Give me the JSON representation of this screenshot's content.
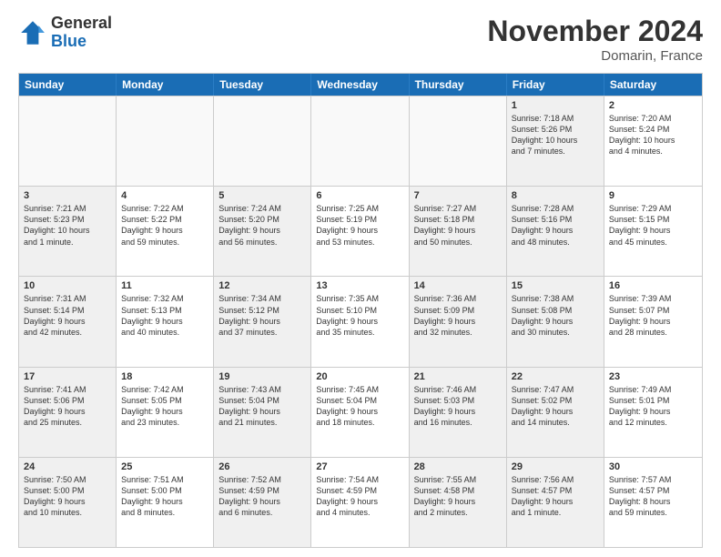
{
  "header": {
    "logo_general": "General",
    "logo_blue": "Blue",
    "month_title": "November 2024",
    "location": "Domarin, France"
  },
  "calendar": {
    "days_of_week": [
      "Sunday",
      "Monday",
      "Tuesday",
      "Wednesday",
      "Thursday",
      "Friday",
      "Saturday"
    ],
    "rows": [
      [
        {
          "day": "",
          "empty": true
        },
        {
          "day": "",
          "empty": true
        },
        {
          "day": "",
          "empty": true
        },
        {
          "day": "",
          "empty": true
        },
        {
          "day": "",
          "empty": true
        },
        {
          "day": "1",
          "text": "Sunrise: 7:18 AM\nSunset: 5:26 PM\nDaylight: 10 hours\nand 7 minutes.",
          "shaded": true
        },
        {
          "day": "2",
          "text": "Sunrise: 7:20 AM\nSunset: 5:24 PM\nDaylight: 10 hours\nand 4 minutes.",
          "shaded": false
        }
      ],
      [
        {
          "day": "3",
          "text": "Sunrise: 7:21 AM\nSunset: 5:23 PM\nDaylight: 10 hours\nand 1 minute.",
          "shaded": true
        },
        {
          "day": "4",
          "text": "Sunrise: 7:22 AM\nSunset: 5:22 PM\nDaylight: 9 hours\nand 59 minutes.",
          "shaded": false
        },
        {
          "day": "5",
          "text": "Sunrise: 7:24 AM\nSunset: 5:20 PM\nDaylight: 9 hours\nand 56 minutes.",
          "shaded": true
        },
        {
          "day": "6",
          "text": "Sunrise: 7:25 AM\nSunset: 5:19 PM\nDaylight: 9 hours\nand 53 minutes.",
          "shaded": false
        },
        {
          "day": "7",
          "text": "Sunrise: 7:27 AM\nSunset: 5:18 PM\nDaylight: 9 hours\nand 50 minutes.",
          "shaded": true
        },
        {
          "day": "8",
          "text": "Sunrise: 7:28 AM\nSunset: 5:16 PM\nDaylight: 9 hours\nand 48 minutes.",
          "shaded": true
        },
        {
          "day": "9",
          "text": "Sunrise: 7:29 AM\nSunset: 5:15 PM\nDaylight: 9 hours\nand 45 minutes.",
          "shaded": false
        }
      ],
      [
        {
          "day": "10",
          "text": "Sunrise: 7:31 AM\nSunset: 5:14 PM\nDaylight: 9 hours\nand 42 minutes.",
          "shaded": true
        },
        {
          "day": "11",
          "text": "Sunrise: 7:32 AM\nSunset: 5:13 PM\nDaylight: 9 hours\nand 40 minutes.",
          "shaded": false
        },
        {
          "day": "12",
          "text": "Sunrise: 7:34 AM\nSunset: 5:12 PM\nDaylight: 9 hours\nand 37 minutes.",
          "shaded": true
        },
        {
          "day": "13",
          "text": "Sunrise: 7:35 AM\nSunset: 5:10 PM\nDaylight: 9 hours\nand 35 minutes.",
          "shaded": false
        },
        {
          "day": "14",
          "text": "Sunrise: 7:36 AM\nSunset: 5:09 PM\nDaylight: 9 hours\nand 32 minutes.",
          "shaded": true
        },
        {
          "day": "15",
          "text": "Sunrise: 7:38 AM\nSunset: 5:08 PM\nDaylight: 9 hours\nand 30 minutes.",
          "shaded": true
        },
        {
          "day": "16",
          "text": "Sunrise: 7:39 AM\nSunset: 5:07 PM\nDaylight: 9 hours\nand 28 minutes.",
          "shaded": false
        }
      ],
      [
        {
          "day": "17",
          "text": "Sunrise: 7:41 AM\nSunset: 5:06 PM\nDaylight: 9 hours\nand 25 minutes.",
          "shaded": true
        },
        {
          "day": "18",
          "text": "Sunrise: 7:42 AM\nSunset: 5:05 PM\nDaylight: 9 hours\nand 23 minutes.",
          "shaded": false
        },
        {
          "day": "19",
          "text": "Sunrise: 7:43 AM\nSunset: 5:04 PM\nDaylight: 9 hours\nand 21 minutes.",
          "shaded": true
        },
        {
          "day": "20",
          "text": "Sunrise: 7:45 AM\nSunset: 5:04 PM\nDaylight: 9 hours\nand 18 minutes.",
          "shaded": false
        },
        {
          "day": "21",
          "text": "Sunrise: 7:46 AM\nSunset: 5:03 PM\nDaylight: 9 hours\nand 16 minutes.",
          "shaded": true
        },
        {
          "day": "22",
          "text": "Sunrise: 7:47 AM\nSunset: 5:02 PM\nDaylight: 9 hours\nand 14 minutes.",
          "shaded": true
        },
        {
          "day": "23",
          "text": "Sunrise: 7:49 AM\nSunset: 5:01 PM\nDaylight: 9 hours\nand 12 minutes.",
          "shaded": false
        }
      ],
      [
        {
          "day": "24",
          "text": "Sunrise: 7:50 AM\nSunset: 5:00 PM\nDaylight: 9 hours\nand 10 minutes.",
          "shaded": true
        },
        {
          "day": "25",
          "text": "Sunrise: 7:51 AM\nSunset: 5:00 PM\nDaylight: 9 hours\nand 8 minutes.",
          "shaded": false
        },
        {
          "day": "26",
          "text": "Sunrise: 7:52 AM\nSunset: 4:59 PM\nDaylight: 9 hours\nand 6 minutes.",
          "shaded": true
        },
        {
          "day": "27",
          "text": "Sunrise: 7:54 AM\nSunset: 4:59 PM\nDaylight: 9 hours\nand 4 minutes.",
          "shaded": false
        },
        {
          "day": "28",
          "text": "Sunrise: 7:55 AM\nSunset: 4:58 PM\nDaylight: 9 hours\nand 2 minutes.",
          "shaded": true
        },
        {
          "day": "29",
          "text": "Sunrise: 7:56 AM\nSunset: 4:57 PM\nDaylight: 9 hours\nand 1 minute.",
          "shaded": true
        },
        {
          "day": "30",
          "text": "Sunrise: 7:57 AM\nSunset: 4:57 PM\nDaylight: 8 hours\nand 59 minutes.",
          "shaded": false
        }
      ]
    ]
  }
}
